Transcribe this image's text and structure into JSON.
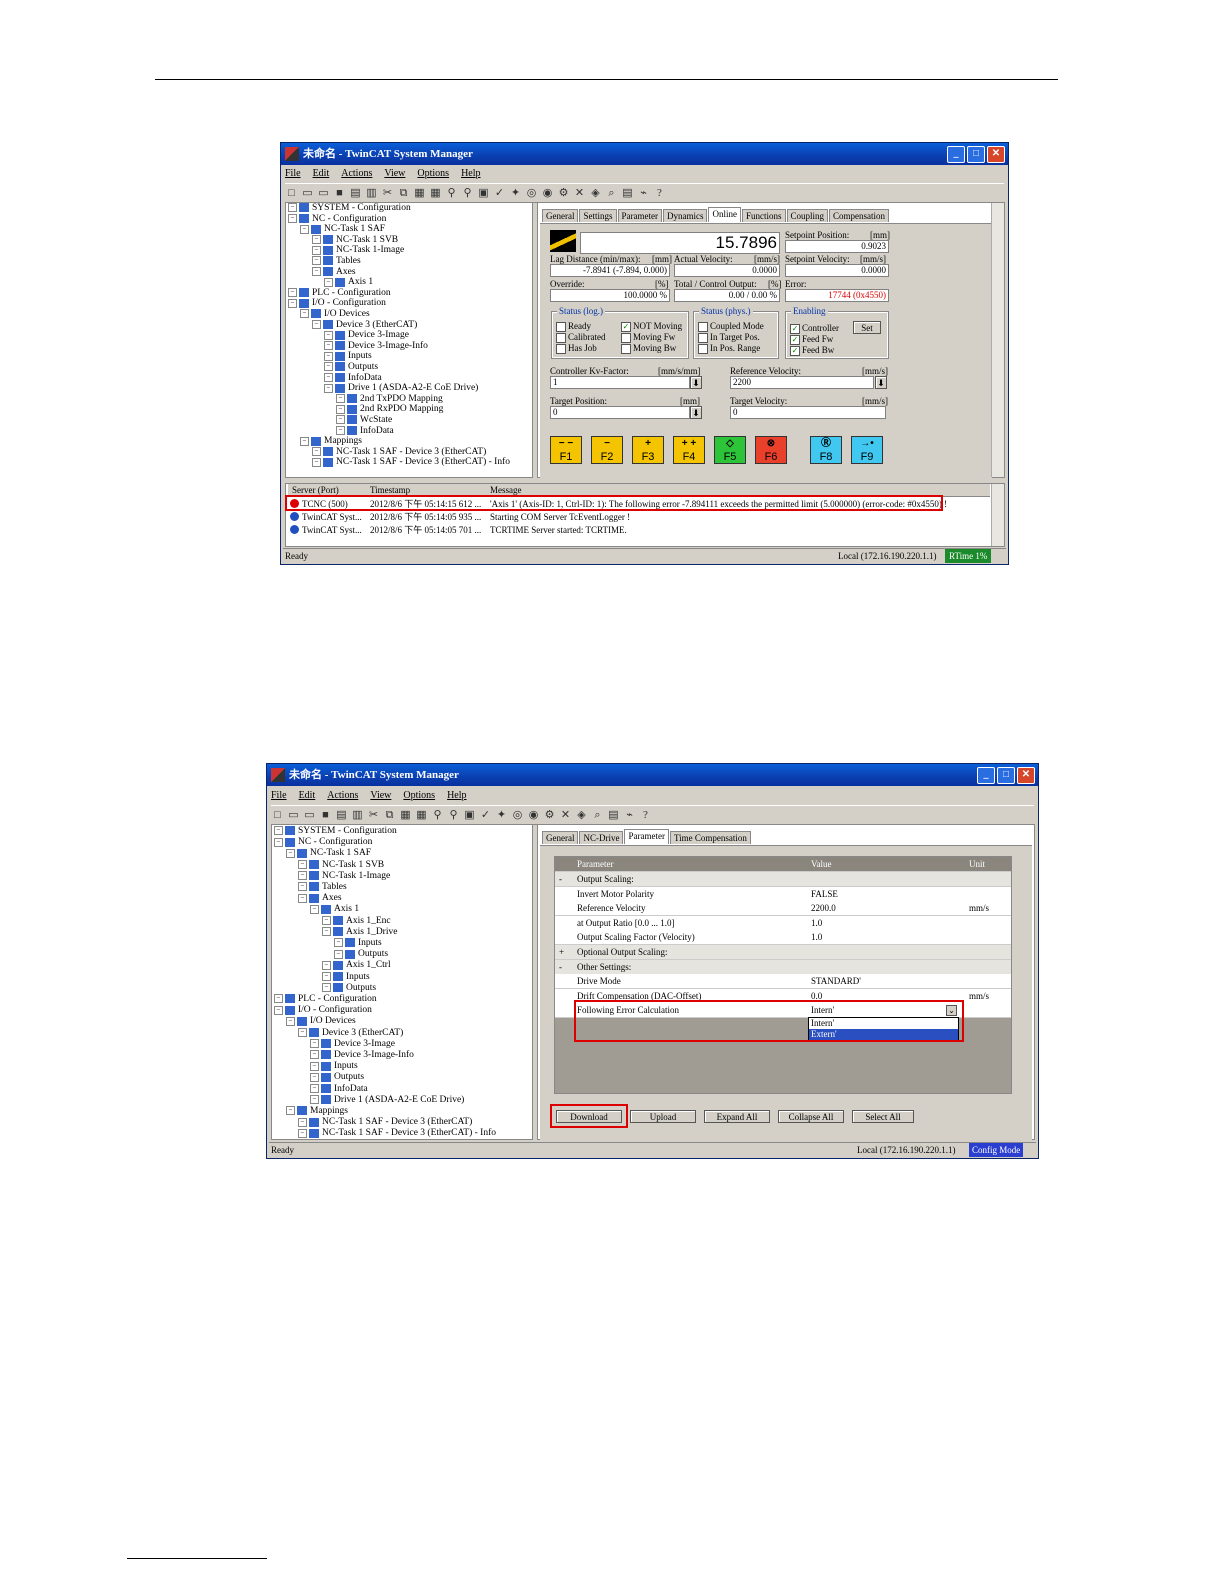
{
  "window1": {
    "title": "未命名 - TwinCAT System Manager",
    "menu": [
      "File",
      "Edit",
      "Actions",
      "View",
      "Options",
      "Help"
    ],
    "tree": [
      {
        "text": "SYSTEM - Configuration",
        "level": 0
      },
      {
        "text": "NC - Configuration",
        "level": 0
      },
      {
        "text": "NC-Task 1 SAF",
        "level": 1
      },
      {
        "text": "NC-Task 1 SVB",
        "level": 2
      },
      {
        "text": "NC-Task 1-Image",
        "level": 2
      },
      {
        "text": "Tables",
        "level": 2
      },
      {
        "text": "Axes",
        "level": 2
      },
      {
        "text": "Axis 1",
        "level": 3
      },
      {
        "text": "PLC - Configuration",
        "level": 0
      },
      {
        "text": "I/O - Configuration",
        "level": 0
      },
      {
        "text": "I/O Devices",
        "level": 1
      },
      {
        "text": "Device 3 (EtherCAT)",
        "level": 2
      },
      {
        "text": "Device 3-Image",
        "level": 3
      },
      {
        "text": "Device 3-Image-Info",
        "level": 3
      },
      {
        "text": "Inputs",
        "level": 3
      },
      {
        "text": "Outputs",
        "level": 3
      },
      {
        "text": "InfoData",
        "level": 3
      },
      {
        "text": "Drive 1 (ASDA-A2-E CoE Drive)",
        "level": 3
      },
      {
        "text": "2nd TxPDO Mapping",
        "level": 4
      },
      {
        "text": "2nd RxPDO Mapping",
        "level": 4
      },
      {
        "text": "WcState",
        "level": 4
      },
      {
        "text": "InfoData",
        "level": 4
      },
      {
        "text": "Mappings",
        "level": 1
      },
      {
        "text": "NC-Task 1 SAF - Device 3 (EtherCAT)",
        "level": 2
      },
      {
        "text": "NC-Task 1 SAF - Device 3 (EtherCAT) - Info",
        "level": 2
      }
    ],
    "tabs": [
      "General",
      "Settings",
      "Parameter",
      "Dynamics",
      "Online",
      "Functions",
      "Coupling",
      "Compensation"
    ],
    "active_tab": "Online",
    "online": {
      "position_value": "15.7896",
      "setpoint_position_label": "Setpoint Position:",
      "setpoint_position_unit": "[mm]",
      "setpoint_position_value": "0.9023",
      "lag_label": "Lag Distance (min/max):",
      "lag_unit": "[mm]",
      "lag_value": "-7.8941  (-7.894, 0.000)",
      "actual_velocity_label": "Actual Velocity:",
      "actual_velocity_unit": "[mm/s]",
      "actual_velocity_value": "0.0000",
      "setpoint_velocity_label": "Setpoint Velocity:",
      "setpoint_velocity_unit": "[mm/s]",
      "setpoint_velocity_value": "0.0000",
      "override_label": "Override:",
      "override_unit": "[%]",
      "override_value": "100.0000 %",
      "total_output_label": "Total / Control Output:",
      "total_output_unit": "[%]",
      "total_output_value": "0.00 / 0.00 %",
      "error_label": "Error:",
      "error_value": "17744 (0x4550)",
      "status_log_title": "Status (log.)",
      "status_log": [
        "Ready",
        "Calibrated",
        "Has Job",
        "NOT Moving",
        "Moving Fw",
        "Moving Bw"
      ],
      "status_phys_title": "Status (phys.)",
      "status_phys": [
        "Coupled Mode",
        "In Target Pos.",
        "In Pos. Range"
      ],
      "enabling_title": "Enabling",
      "enabling": [
        "Controller",
        "Feed Fw",
        "Feed Bw"
      ],
      "set_button": "Set",
      "kv_label": "Controller Kv-Factor:",
      "kv_unit": "[mm/s/mm]",
      "kv_value": "1",
      "ref_velocity_label": "Reference Velocity:",
      "ref_velocity_unit": "[mm/s]",
      "ref_velocity_value": "2200",
      "target_position_label": "Target Position:",
      "target_position_unit": "[mm]",
      "target_position_value": "0",
      "target_velocity_label": "Target Velocity:",
      "target_velocity_unit": "[mm/s]",
      "target_velocity_value": "0",
      "fkeys": [
        {
          "sym": "− −",
          "key": "F1",
          "color": "#f5c400"
        },
        {
          "sym": "−",
          "key": "F2",
          "color": "#f5c400"
        },
        {
          "sym": "+",
          "key": "F3",
          "color": "#f5c400"
        },
        {
          "sym": "+ +",
          "key": "F4",
          "color": "#f5c400"
        },
        {
          "sym": "◇",
          "key": "F5",
          "color": "#2ec43a"
        },
        {
          "sym": "⊗",
          "key": "F6",
          "color": "#e8402a"
        },
        {
          "sym": "Ⓡ",
          "key": "F8",
          "color": "#40c8f0"
        },
        {
          "sym": "→•",
          "key": "F9",
          "color": "#40c8f0"
        }
      ]
    },
    "log": {
      "headers": [
        "Server (Port)",
        "Timestamp",
        "Message"
      ],
      "rows": [
        {
          "server": "TCNC (500)",
          "time": "2012/8/6 下午 05:14:15 612 ...",
          "message": "'Axis 1' (Axis-ID: 1, Ctrl-ID: 1): The following error -7.894111 exceeds the permitted limit (5.000000) (error-code: #0x4550) !"
        },
        {
          "server": "TwinCAT Syst...",
          "time": "2012/8/6 下午 05:14:05 935 ...",
          "message": "Starting COM Server TcEventLogger !"
        },
        {
          "server": "TwinCAT Syst...",
          "time": "2012/8/6 下午 05:14:05 701 ...",
          "message": "TCRTIME Server started: TCRTIME."
        }
      ]
    },
    "status": {
      "left": "Ready",
      "address": "Local (172.16.190.220.1.1)",
      "mode": "RTime 1%"
    }
  },
  "window2": {
    "title": "未命名 - TwinCAT System Manager",
    "menu": [
      "File",
      "Edit",
      "Actions",
      "View",
      "Options",
      "Help"
    ],
    "tree": [
      {
        "text": "SYSTEM - Configuration",
        "level": 0
      },
      {
        "text": "NC - Configuration",
        "level": 0
      },
      {
        "text": "NC-Task 1 SAF",
        "level": 1
      },
      {
        "text": "NC-Task 1 SVB",
        "level": 2
      },
      {
        "text": "NC-Task 1-Image",
        "level": 2
      },
      {
        "text": "Tables",
        "level": 2
      },
      {
        "text": "Axes",
        "level": 2
      },
      {
        "text": "Axis 1",
        "level": 3
      },
      {
        "text": "Axis 1_Enc",
        "level": 4
      },
      {
        "text": "Axis 1_Drive",
        "level": 4
      },
      {
        "text": "Inputs",
        "level": 5
      },
      {
        "text": "Outputs",
        "level": 5
      },
      {
        "text": "Axis 1_Ctrl",
        "level": 4
      },
      {
        "text": "Inputs",
        "level": 4
      },
      {
        "text": "Outputs",
        "level": 4
      },
      {
        "text": "PLC - Configuration",
        "level": 0
      },
      {
        "text": "I/O - Configuration",
        "level": 0
      },
      {
        "text": "I/O Devices",
        "level": 1
      },
      {
        "text": "Device 3 (EtherCAT)",
        "level": 2
      },
      {
        "text": "Device 3-Image",
        "level": 3
      },
      {
        "text": "Device 3-Image-Info",
        "level": 3
      },
      {
        "text": "Inputs",
        "level": 3
      },
      {
        "text": "Outputs",
        "level": 3
      },
      {
        "text": "InfoData",
        "level": 3
      },
      {
        "text": "Drive 1 (ASDA-A2-E CoE Drive)",
        "level": 3
      },
      {
        "text": "Mappings",
        "level": 1
      },
      {
        "text": "NC-Task 1 SAF - Device 3 (EtherCAT)",
        "level": 2
      },
      {
        "text": "NC-Task 1 SAF - Device 3 (EtherCAT) - Info",
        "level": 2
      }
    ],
    "tabs": [
      "General",
      "NC-Drive",
      "Parameter",
      "Time Compensation"
    ],
    "active_tab": "Parameter",
    "grid": {
      "headers": [
        "Parameter",
        "Value",
        "Unit"
      ],
      "rows": [
        {
          "mark": "-",
          "name": "Output Scaling:",
          "value": "",
          "unit": "",
          "group": true
        },
        {
          "mark": "",
          "name": "Invert Motor Polarity",
          "value": "FALSE",
          "unit": ""
        },
        {
          "mark": "",
          "name": "Reference Velocity",
          "value": "2200.0",
          "unit": "mm/s"
        },
        {
          "mark": "",
          "name": "at Output Ratio [0.0 ... 1.0]",
          "value": "1.0",
          "unit": ""
        },
        {
          "mark": "",
          "name": "Output Scaling Factor (Velocity)",
          "value": "1.0",
          "unit": ""
        },
        {
          "mark": "+",
          "name": "Optional Output Scaling:",
          "value": "",
          "unit": "",
          "group": true
        },
        {
          "mark": "-",
          "name": "Other Settings:",
          "value": "",
          "unit": "",
          "group": true
        },
        {
          "mark": "",
          "name": "Drive Mode",
          "value": "STANDARD'",
          "unit": ""
        },
        {
          "mark": "",
          "name": "Drift Compensation (DAC-Offset)",
          "value": "0.0",
          "unit": "mm/s"
        },
        {
          "mark": "",
          "name": "Following Error Calculation",
          "value": "Intern'",
          "unit": ""
        }
      ],
      "dropdown_options": [
        "Intern'",
        "Extern'"
      ],
      "dropdown_selected": "Extern'"
    },
    "buttons": [
      "Download",
      "Upload",
      "Expand All",
      "Collapse All",
      "Select All"
    ],
    "status": {
      "left": "Ready",
      "address": "Local (172.16.190.220.1.1)",
      "mode": "Config Mode"
    }
  }
}
